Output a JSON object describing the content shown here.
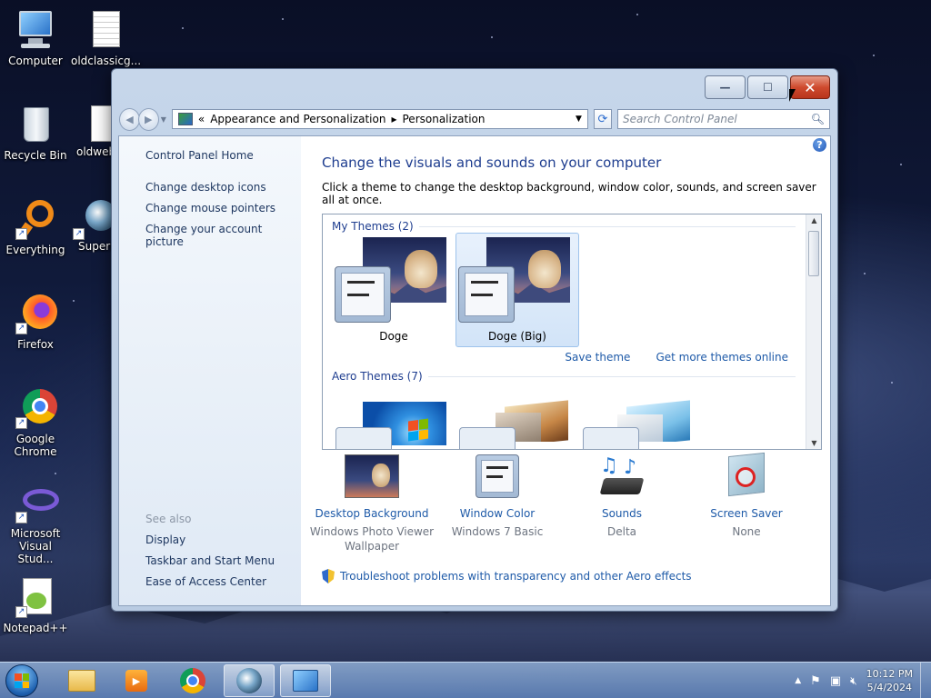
{
  "desktop": {
    "icons": [
      {
        "label": "Computer"
      },
      {
        "label": "oldclassicg..."
      },
      {
        "label": "Recycle Bin"
      },
      {
        "label": "oldweb"
      },
      {
        "label": "Everything"
      },
      {
        "label": "Supern"
      },
      {
        "label": "Firefox"
      },
      {
        "label": "Google Chrome"
      },
      {
        "label": "Microsoft Visual Stud..."
      },
      {
        "label": "Notepad++"
      }
    ]
  },
  "window": {
    "caption": {
      "minimize": "—",
      "maximize": "☐",
      "close": "✕"
    },
    "address": {
      "separator": "«",
      "crumb1": "Appearance and Personalization",
      "arrow": "▸",
      "crumb2": "Personalization"
    },
    "search": {
      "placeholder": "Search Control Panel"
    },
    "sidebar": {
      "home": "Control Panel Home",
      "links": [
        "Change desktop icons",
        "Change mouse pointers",
        "Change your account picture"
      ],
      "see_also_header": "See also",
      "see_also": [
        "Display",
        "Taskbar and Start Menu",
        "Ease of Access Center"
      ]
    },
    "main": {
      "help": "?",
      "title": "Change the visuals and sounds on your computer",
      "subtitle": "Click a theme to change the desktop background, window color, sounds, and screen saver all at once.",
      "my_themes_header": "My Themes (2)",
      "themes": [
        {
          "name": "Doge",
          "selected": false
        },
        {
          "name": "Doge (Big)",
          "selected": true
        }
      ],
      "save_theme": "Save theme",
      "more_themes": "Get more themes online",
      "aero_header": "Aero Themes (7)",
      "options": [
        {
          "label": "Desktop Background",
          "value": "Windows Photo Viewer Wallpaper"
        },
        {
          "label": "Window Color",
          "value": "Windows 7 Basic"
        },
        {
          "label": "Sounds",
          "value": "Delta"
        },
        {
          "label": "Screen Saver",
          "value": "None"
        }
      ],
      "troubleshoot": "Troubleshoot problems with transparency and other Aero effects"
    }
  },
  "taskbar": {
    "clock_time": "10:12 PM",
    "clock_date": "5/4/2024"
  },
  "colors": {
    "link": "#1e5aa8",
    "title": "#1e3d8f",
    "close_button": "#cf4a2e"
  }
}
